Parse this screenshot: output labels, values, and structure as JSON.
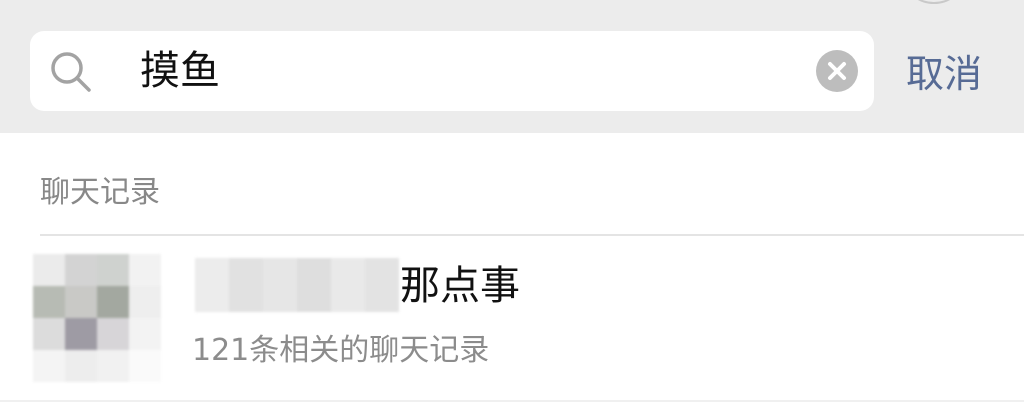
{
  "search": {
    "query": "摸鱼",
    "cancel_label": "取消",
    "icons": {
      "search": "search-icon",
      "clear": "clear-icon"
    }
  },
  "section": {
    "title": "聊天记录"
  },
  "results": [
    {
      "name_visible": "那点事",
      "subtitle": "121条相关的聊天记录"
    }
  ],
  "colors": {
    "header_bg": "#ececec",
    "link_blue": "#576b95",
    "clear_btn": "#bdbdbd",
    "secondary_text": "#8c8c8c"
  }
}
